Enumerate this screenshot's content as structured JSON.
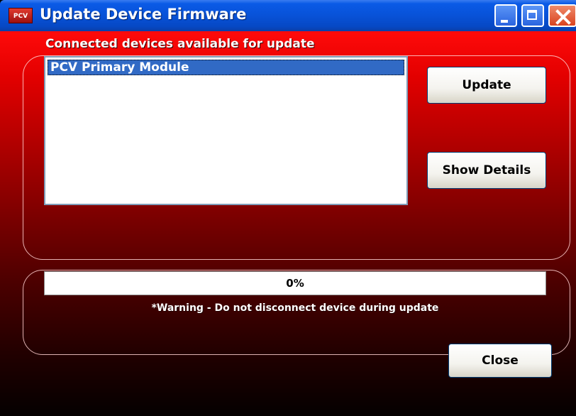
{
  "window": {
    "title": "Update Device Firmware",
    "app_icon_text": "PCV"
  },
  "devices": {
    "label": "Connected devices available for update",
    "items": [
      {
        "label": "PCV Primary Module",
        "selected": true
      }
    ]
  },
  "buttons": {
    "update": "Update",
    "show_details": "Show Details",
    "close": "Close"
  },
  "progress": {
    "percent": 0,
    "text": "0%"
  },
  "warning": "*Warning - Do not disconnect device during update",
  "colors": {
    "titlebar": "#0852d8",
    "background_top": "#ff0a0a",
    "background_bottom": "#040000",
    "selection": "#316ac5"
  }
}
